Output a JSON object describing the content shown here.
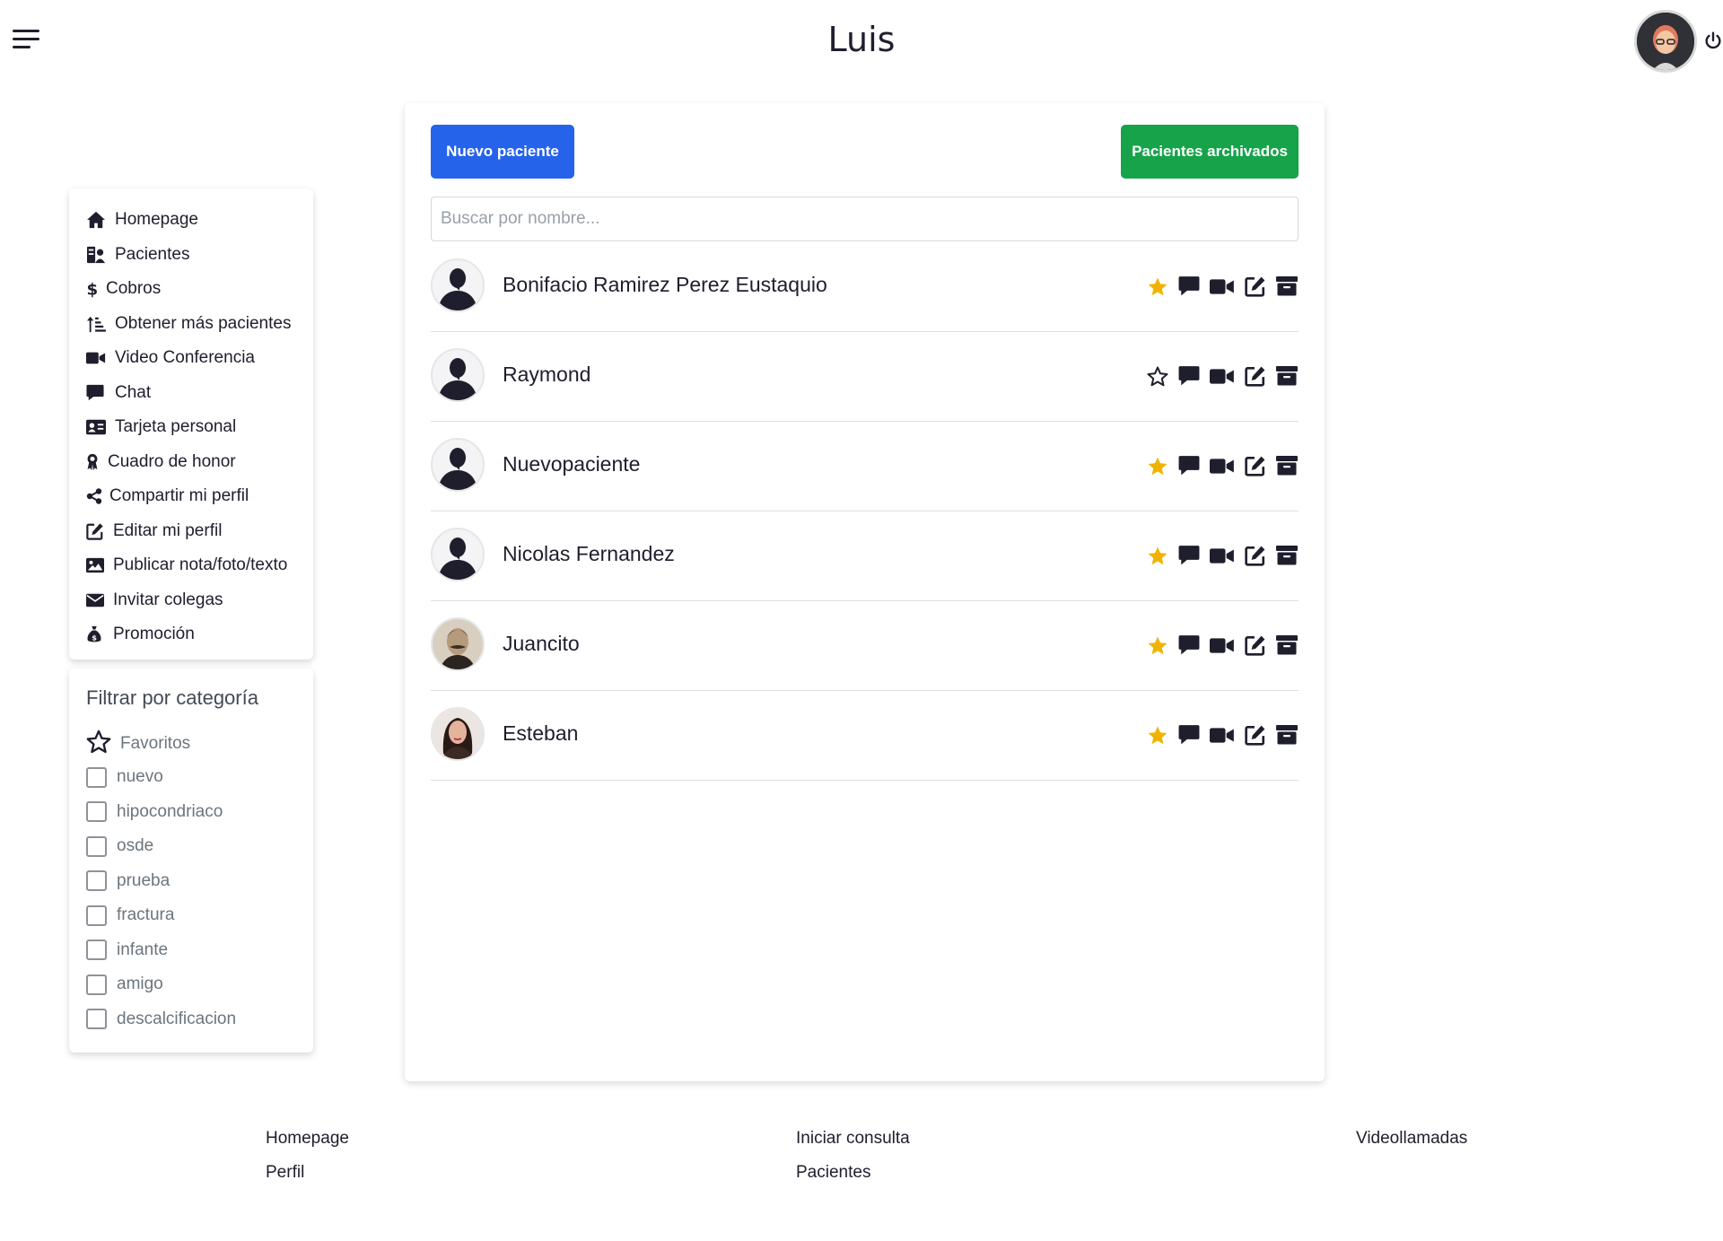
{
  "header": {
    "title": "Luis"
  },
  "nav": {
    "items": [
      {
        "label": "Homepage",
        "icon": "home-icon"
      },
      {
        "label": "Pacientes",
        "icon": "patients-icon"
      },
      {
        "label": "Cobros",
        "icon": "dollar-icon"
      },
      {
        "label": "Obtener más pacientes",
        "icon": "sort-up-icon"
      },
      {
        "label": "Video Conferencia",
        "icon": "video-icon"
      },
      {
        "label": "Chat",
        "icon": "chat-icon"
      },
      {
        "label": "Tarjeta personal",
        "icon": "id-card-icon"
      },
      {
        "label": "Cuadro de honor",
        "icon": "award-icon"
      },
      {
        "label": "Compartir mi perfil",
        "icon": "share-icon"
      },
      {
        "label": "Editar mi perfil",
        "icon": "edit-icon"
      },
      {
        "label": "Publicar nota/foto/texto",
        "icon": "image-icon"
      },
      {
        "label": "Invitar colegas",
        "icon": "envelope-icon"
      },
      {
        "label": "Promoción",
        "icon": "money-bag-icon"
      }
    ]
  },
  "filter": {
    "title": "Filtrar por categoría",
    "favorites_label": "Favoritos",
    "categories": [
      "nuevo",
      "hipocondriaco",
      "osde",
      "prueba",
      "fractura",
      "infante",
      "amigo",
      "descalcificacion"
    ]
  },
  "main": {
    "new_patient_label": "Nuevo paciente",
    "archived_label": "Pacientes archivados",
    "search_placeholder": "Buscar por nombre...",
    "patients": [
      {
        "name": "Bonifacio Ramirez Perez Eustaquio",
        "favorite": true,
        "avatar": "silhouette"
      },
      {
        "name": "Raymond",
        "favorite": false,
        "avatar": "silhouette"
      },
      {
        "name": "Nuevopaciente",
        "favorite": true,
        "avatar": "silhouette"
      },
      {
        "name": "Nicolas Fernandez",
        "favorite": true,
        "avatar": "silhouette"
      },
      {
        "name": "Juancito",
        "favorite": true,
        "avatar": "portrait-man"
      },
      {
        "name": "Esteban",
        "favorite": true,
        "avatar": "portrait-woman"
      }
    ]
  },
  "footer": {
    "col1": [
      "Homepage",
      "Perfil"
    ],
    "col2": [
      "Iniciar consulta",
      "Pacientes"
    ],
    "col3": [
      "Videollamadas"
    ]
  },
  "colors": {
    "primary": "#2563eb",
    "success": "#16a34a",
    "star": "#f0b400"
  }
}
